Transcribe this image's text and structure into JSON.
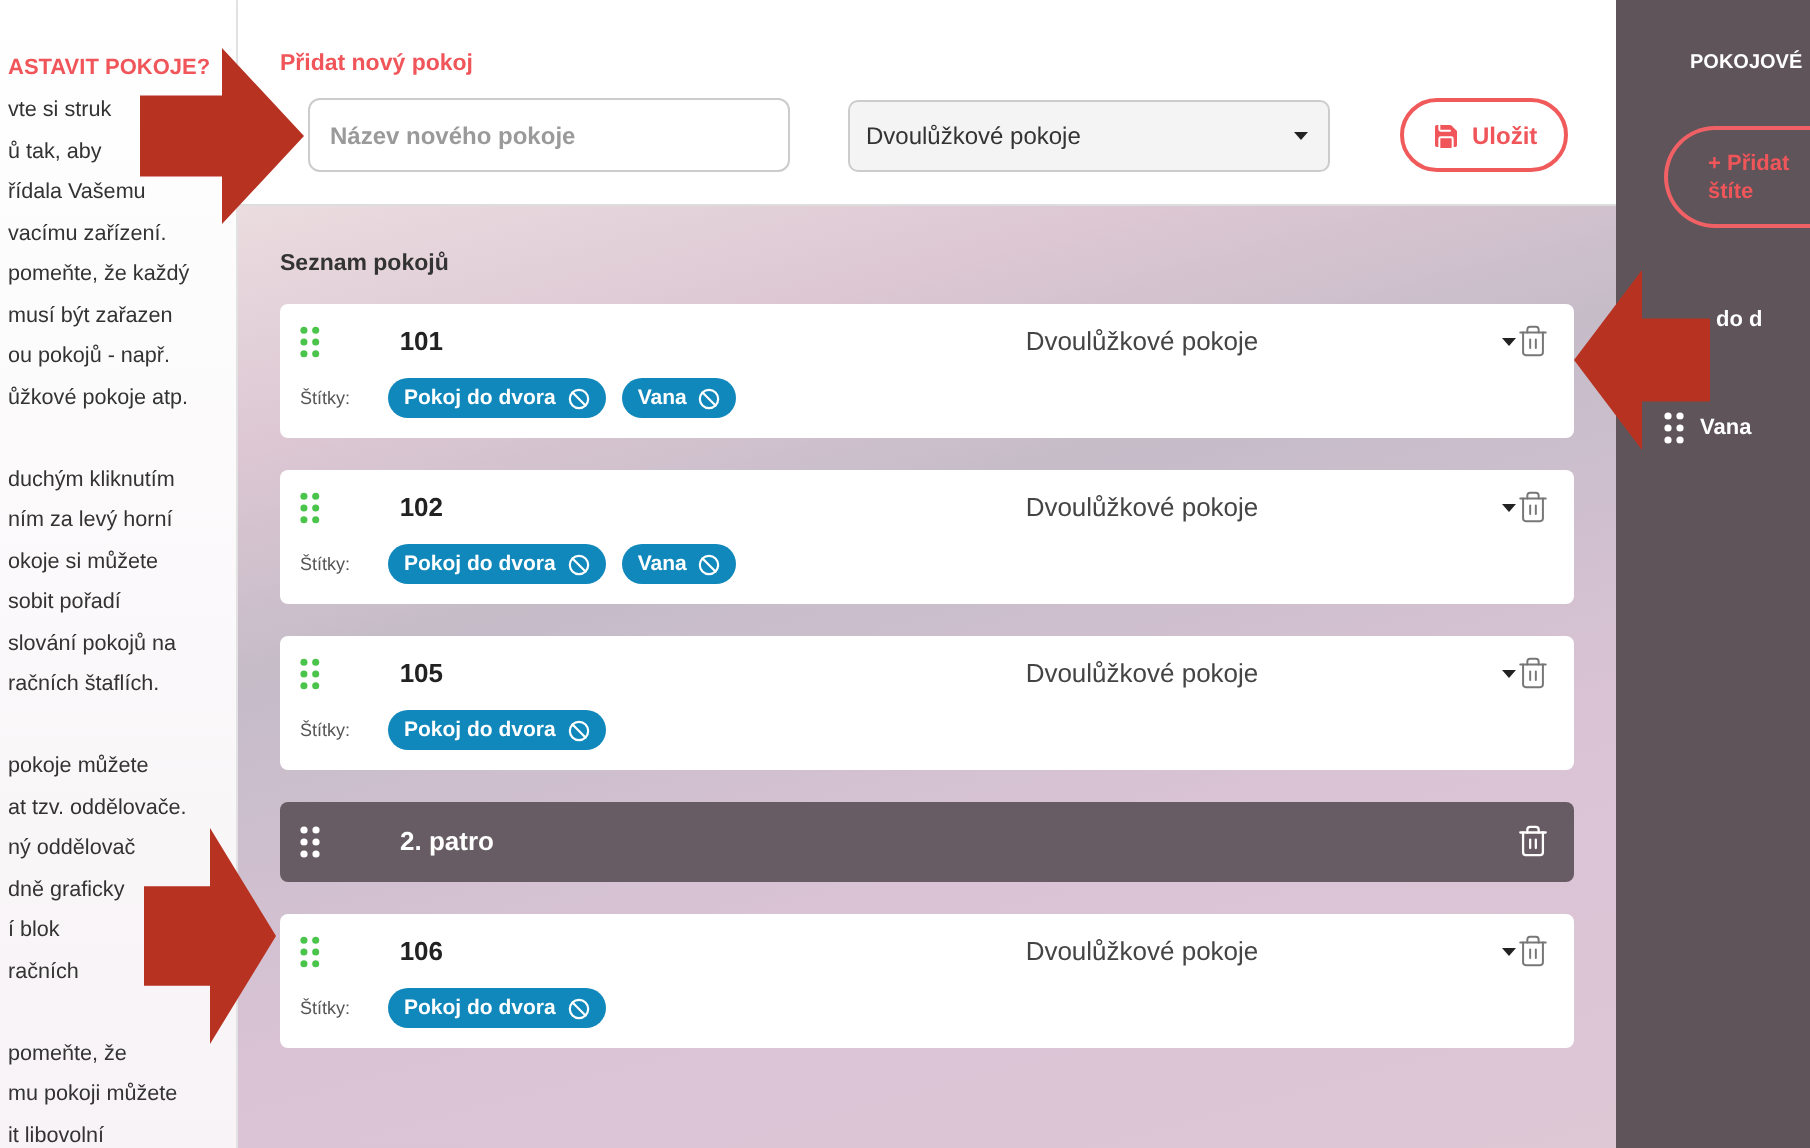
{
  "help_column": {
    "heading": "ASTAVIT POKOJE?",
    "paragraphs": [
      [
        "vte si struk",
        "ů tak, aby",
        "řídala Vašemu",
        "vacímu zařízení.",
        "pomeňte, že každý",
        "musí být zařazen",
        "ou pokojů - např.",
        "ůžkové pokoje atp."
      ],
      [
        "duchým kliknutím",
        "ním za levý horní",
        "okoje si můžete",
        "sobit pořadí",
        "slování pokojů na",
        "račních štaflích."
      ],
      [
        "pokoje můžete",
        "at tzv. oddělovače.",
        "ný oddělovač",
        "dně graficky",
        "í blok",
        "račních"
      ],
      [
        "pomeňte, že",
        "mu pokoji můžete",
        "it libovolní"
      ]
    ]
  },
  "new_room": {
    "label": "Přidat nový pokoj",
    "name_field": {
      "placeholder": "Název nového pokoje"
    },
    "type_select": {
      "value": "Dvoulůžkové pokoje"
    },
    "save_button": "Uložit"
  },
  "room_list": {
    "title": "Seznam pokojů",
    "items": [
      {
        "kind": "room",
        "number": "101",
        "type": "Dvoulůžkové pokoje",
        "tags_label": "Štítky:",
        "tags": [
          "Pokoj do dvora",
          "Vana"
        ]
      },
      {
        "kind": "room",
        "number": "102",
        "type": "Dvoulůžkové pokoje",
        "tags_label": "Štítky:",
        "tags": [
          "Pokoj do dvora",
          "Vana"
        ]
      },
      {
        "kind": "room",
        "number": "105",
        "type": "Dvoulůžkové pokoje",
        "tags_label": "Štítky:",
        "tags": [
          "Pokoj do dvora"
        ]
      },
      {
        "kind": "divider",
        "title": "2. patro"
      },
      {
        "kind": "room",
        "number": "106",
        "type": "Dvoulůžkové pokoje",
        "tags_label": "Štítky:",
        "tags": [
          "Pokoj do dvora"
        ]
      }
    ]
  },
  "tags_panel": {
    "title": "POKOJOVÉ",
    "add_button": {
      "icon": "+",
      "lines": [
        "Přidat",
        "štíte"
      ]
    },
    "tags": [
      {
        "label": "do d",
        "handle": false
      },
      {
        "label": "Vana",
        "handle": true
      }
    ]
  },
  "annotations": [
    {
      "kind": "arrow",
      "points_left": false
    },
    {
      "kind": "arrow",
      "points_left": true
    },
    {
      "kind": "arrow",
      "points_left": false
    }
  ]
}
